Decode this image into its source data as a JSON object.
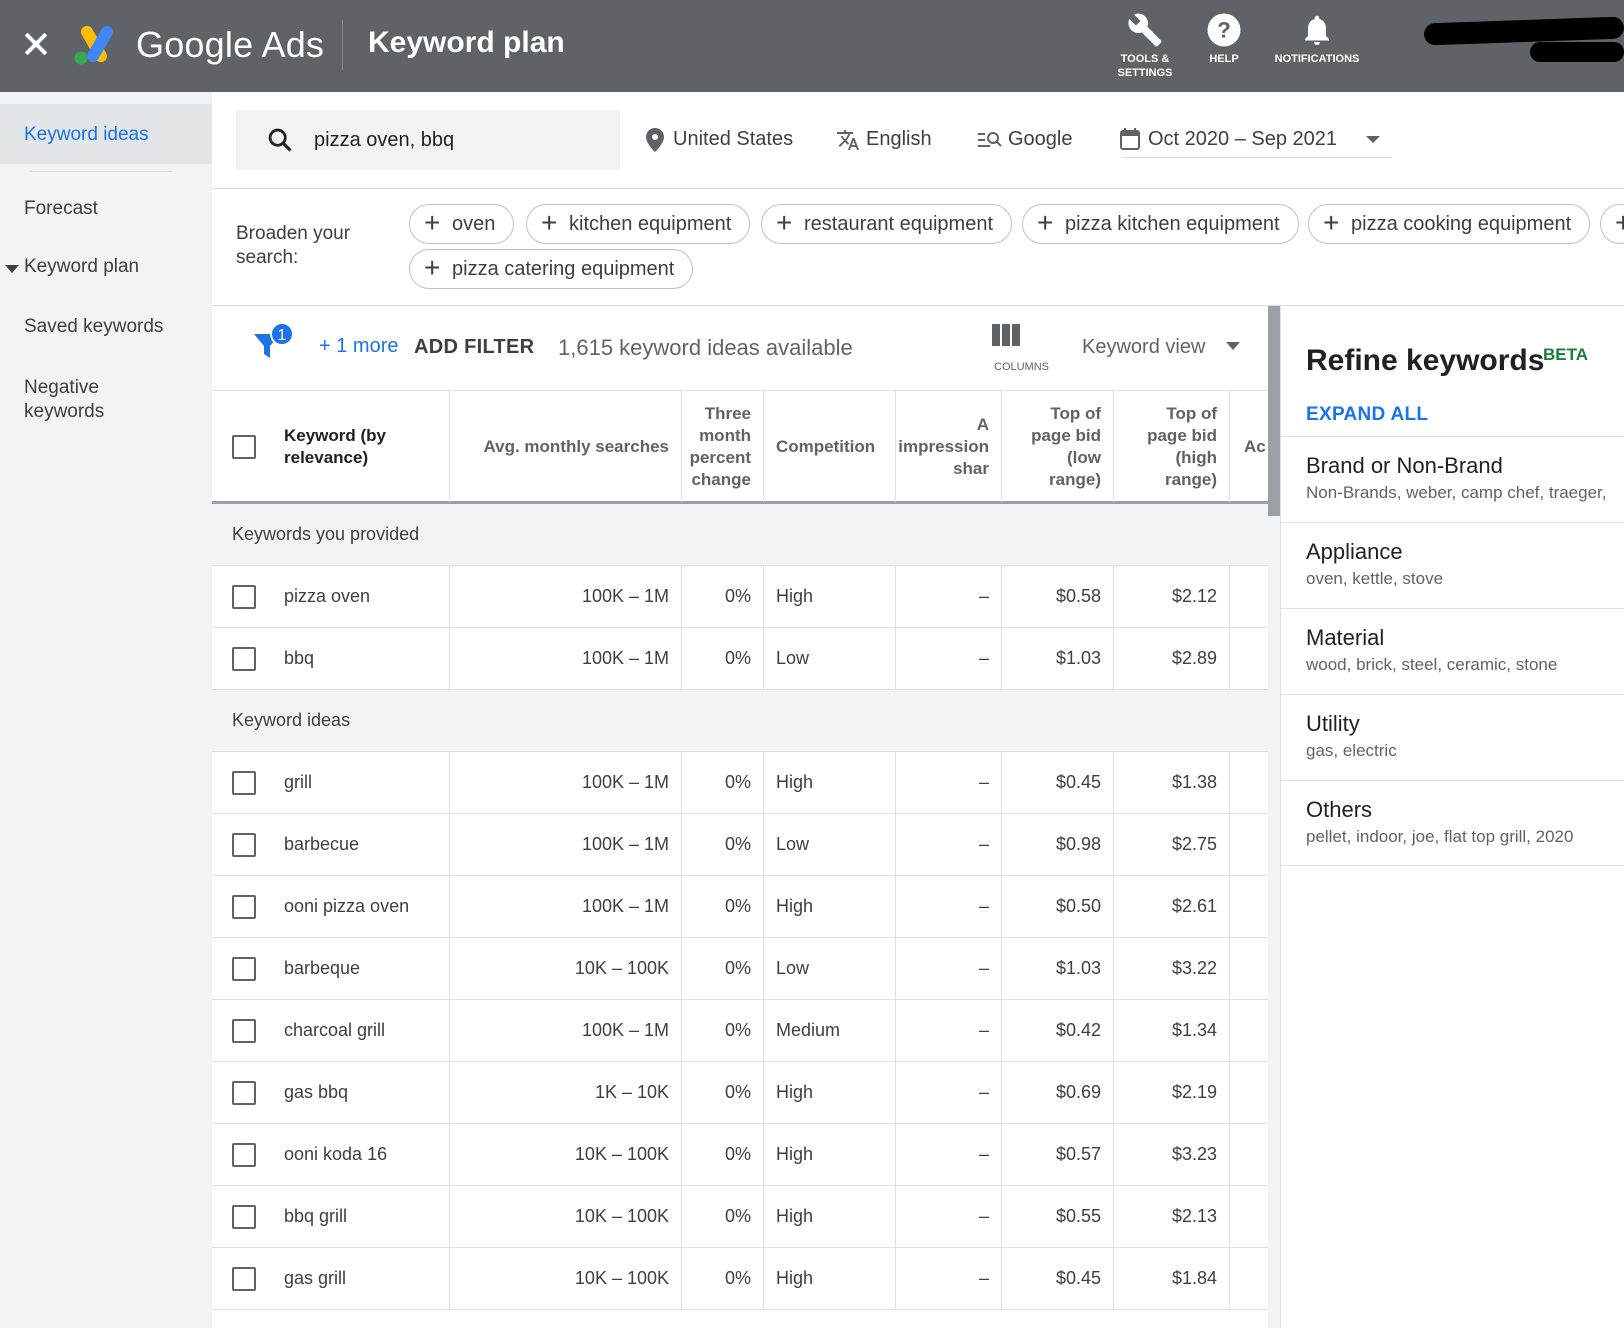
{
  "header": {
    "brand": "Google Ads",
    "page_title": "Keyword plan",
    "actions": [
      {
        "label_line1": "TOOLS &",
        "label_line2": "SETTINGS",
        "icon": "wrench-icon"
      },
      {
        "label_line1": "HELP",
        "label_line2": "",
        "icon": "help-icon"
      },
      {
        "label_line1": "NOTIFICATIONS",
        "label_line2": "",
        "icon": "bell-icon"
      }
    ]
  },
  "sidebar": {
    "items": [
      {
        "label": "Keyword ideas",
        "active": true
      },
      {
        "label": "Forecast"
      },
      {
        "label": "Keyword plan",
        "expandable": true
      },
      {
        "label": "Saved keywords"
      },
      {
        "label": "Negative keywords"
      }
    ]
  },
  "search": {
    "query": "pizza oven, bbq",
    "location": "United States",
    "language": "English",
    "network": "Google",
    "date_range": "Oct 2020 – Sep 2021"
  },
  "broaden": {
    "label": "Broaden your search:",
    "chips": [
      "oven",
      "kitchen equipment",
      "restaurant equipment",
      "pizza kitchen equipment",
      "pizza cooking equipment",
      "pizza catering equipment"
    ]
  },
  "toolbar": {
    "filter_badge": "1",
    "more_link": "+ 1 more",
    "add_filter": "ADD FILTER",
    "ideas_count": "1,615 keyword ideas available",
    "columns_label": "COLUMNS",
    "view_label": "Keyword view"
  },
  "table": {
    "headers": {
      "keyword": "Keyword (by relevance)",
      "avg": "Avg. monthly searches",
      "three_month": "Three month percent change",
      "competition": "Competition",
      "impression": "A impression shar",
      "low_bid": "Top of page bid (low range)",
      "high_bid": "Top of page bid (high range)",
      "account": "Ac"
    },
    "groups": [
      {
        "title": "Keywords you provided",
        "rows": [
          {
            "keyword": "pizza oven",
            "avg": "100K – 1M",
            "change": "0%",
            "competition": "High",
            "impression": "–",
            "low": "$0.58",
            "high": "$2.12"
          },
          {
            "keyword": "bbq",
            "avg": "100K – 1M",
            "change": "0%",
            "competition": "Low",
            "impression": "–",
            "low": "$1.03",
            "high": "$2.89"
          }
        ]
      },
      {
        "title": "Keyword ideas",
        "rows": [
          {
            "keyword": "grill",
            "avg": "100K – 1M",
            "change": "0%",
            "competition": "High",
            "impression": "–",
            "low": "$0.45",
            "high": "$1.38"
          },
          {
            "keyword": "barbecue",
            "avg": "100K – 1M",
            "change": "0%",
            "competition": "Low",
            "impression": "–",
            "low": "$0.98",
            "high": "$2.75"
          },
          {
            "keyword": "ooni pizza oven",
            "avg": "100K – 1M",
            "change": "0%",
            "competition": "High",
            "impression": "–",
            "low": "$0.50",
            "high": "$2.61"
          },
          {
            "keyword": "barbeque",
            "avg": "10K – 100K",
            "change": "0%",
            "competition": "Low",
            "impression": "–",
            "low": "$1.03",
            "high": "$3.22"
          },
          {
            "keyword": "charcoal grill",
            "avg": "100K – 1M",
            "change": "0%",
            "competition": "Medium",
            "impression": "–",
            "low": "$0.42",
            "high": "$1.34"
          },
          {
            "keyword": "gas bbq",
            "avg": "1K – 10K",
            "change": "0%",
            "competition": "High",
            "impression": "–",
            "low": "$0.69",
            "high": "$2.19"
          },
          {
            "keyword": "ooni koda 16",
            "avg": "10K – 100K",
            "change": "0%",
            "competition": "High",
            "impression": "–",
            "low": "$0.57",
            "high": "$3.23"
          },
          {
            "keyword": "bbq grill",
            "avg": "10K – 100K",
            "change": "0%",
            "competition": "High",
            "impression": "–",
            "low": "$0.55",
            "high": "$2.13"
          },
          {
            "keyword": "gas grill",
            "avg": "10K – 100K",
            "change": "0%",
            "competition": "High",
            "impression": "–",
            "low": "$0.45",
            "high": "$1.84"
          }
        ]
      }
    ]
  },
  "refine": {
    "title": "Refine keywords",
    "badge": "BETA",
    "expand_all": "EXPAND ALL",
    "items": [
      {
        "name": "Brand or Non-Brand",
        "sub": "Non-Brands, weber, camp chef, traeger,"
      },
      {
        "name": "Appliance",
        "sub": "oven, kettle, stove"
      },
      {
        "name": "Material",
        "sub": "wood, brick, steel, ceramic, stone"
      },
      {
        "name": "Utility",
        "sub": "gas, electric"
      },
      {
        "name": "Others",
        "sub": "pellet, indoor, joe, flat top grill, 2020"
      }
    ]
  },
  "colors": {
    "header_bg": "#5f6368",
    "accent_blue": "#1a73e8",
    "beta_green": "#188038",
    "logo_yellow": "#fbbc04",
    "logo_blue": "#4285f4",
    "logo_green": "#34a853"
  }
}
